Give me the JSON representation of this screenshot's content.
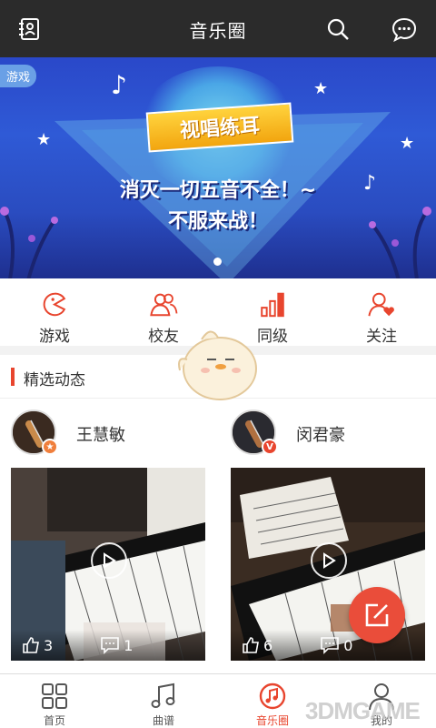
{
  "header": {
    "title": "音乐圈"
  },
  "banner": {
    "tag": "游戏",
    "headline": "视唱练耳",
    "line1": "消灭一切五音不全！~",
    "line2": "不服来战！"
  },
  "categories": [
    {
      "label": "游戏",
      "icon": "pacman-icon"
    },
    {
      "label": "校友",
      "icon": "people-icon"
    },
    {
      "label": "同级",
      "icon": "bars-icon"
    },
    {
      "label": "关注",
      "icon": "heart-person-icon"
    }
  ],
  "section": {
    "title": "精选动态"
  },
  "posts": [
    {
      "name": "王慧敏",
      "likes": "3",
      "comments": "1",
      "badge": "star",
      "badge_color": "#f07f3c"
    },
    {
      "name": "闵君豪",
      "likes": "6",
      "comments": "0",
      "badge": "V",
      "badge_color": "#e8452e"
    }
  ],
  "tabs": [
    {
      "label": "首页",
      "icon": "home-grid-icon"
    },
    {
      "label": "曲谱",
      "icon": "music-note-icon"
    },
    {
      "label": "音乐圈",
      "icon": "music-circle-icon",
      "active": true
    },
    {
      "label": "我的",
      "icon": "person-icon"
    }
  ],
  "watermark": "3DMGAME",
  "colors": {
    "accent": "#e8452e",
    "topbar": "#2b2b2b"
  }
}
